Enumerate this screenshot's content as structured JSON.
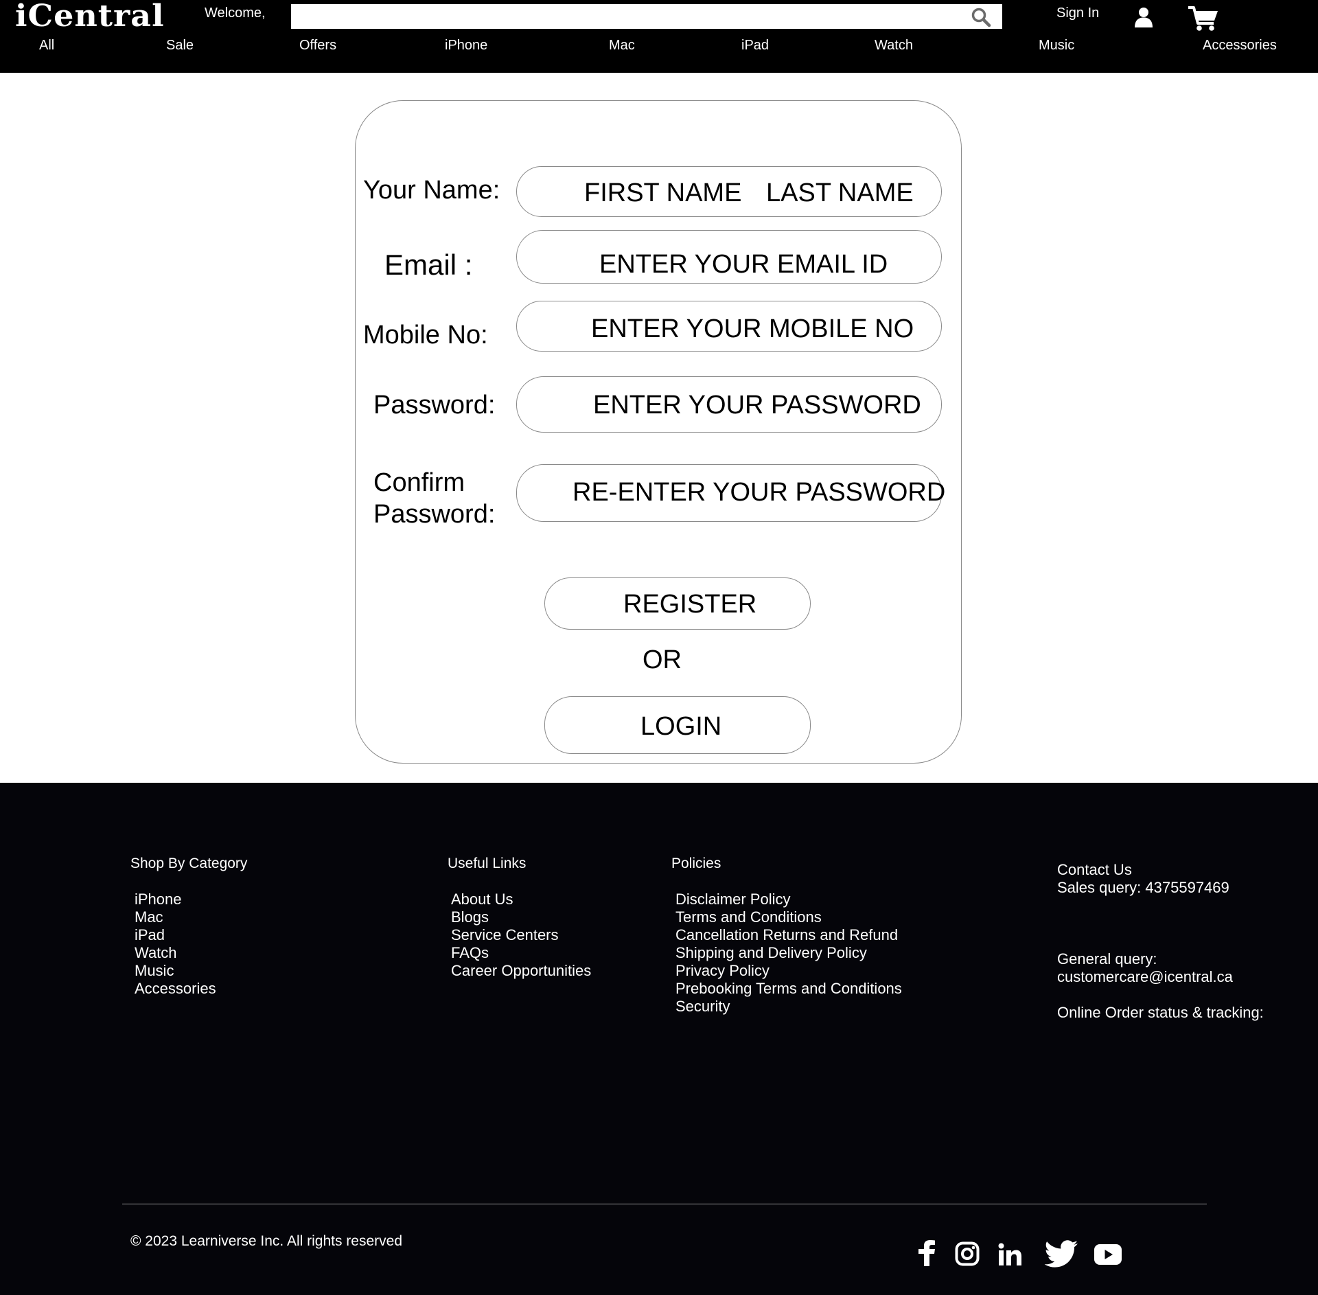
{
  "header": {
    "logo": "iCentral",
    "welcome": "Welcome,",
    "search_icon": "search-icon",
    "sign_in": "Sign In",
    "user_icon": "user-icon",
    "cart_icon": "cart-icon",
    "nav": [
      "All",
      "Sale",
      "Offers",
      "iPhone",
      "Mac",
      "iPad",
      "Watch",
      "Music",
      "Accessories"
    ]
  },
  "form": {
    "name_label": "Your Name:",
    "first_name_placeholder": "FIRST NAME",
    "last_name_placeholder": "LAST NAME",
    "email_label": "Email :",
    "email_placeholder": "ENTER YOUR EMAIL ID",
    "mobile_label": "Mobile No:",
    "mobile_placeholder": "ENTER YOUR MOBILE NO",
    "password_label": "Password:",
    "password_placeholder": "ENTER YOUR PASSWORD",
    "confirm_label_line1": "Confirm",
    "confirm_label_line2": "Password:",
    "confirm_placeholder": "RE-ENTER YOUR PASSWORD",
    "register_button": "REGISTER",
    "or_text": "OR",
    "login_button": "LOGIN"
  },
  "footer": {
    "shop_heading": "Shop By Category",
    "shop_items": [
      "iPhone",
      "Mac",
      "iPad",
      "Watch",
      "Music",
      "Accessories"
    ],
    "links_heading": "Useful Links",
    "links_items": [
      "About Us",
      "Blogs",
      "Service Centers",
      "FAQs",
      "Career Opportunities"
    ],
    "policies_heading": "Policies",
    "policies_items": [
      "Disclaimer Policy",
      "Terms and Conditions",
      "Cancellation Returns and Refund",
      "Shipping and Delivery Policy",
      "Privacy Policy",
      "Prebooking Terms and Conditions",
      "Security"
    ],
    "contact_heading": "Contact Us",
    "sales_query": "Sales query: 4375597469",
    "general_query_label": "General query:",
    "general_query_email": "customercare@icentral.ca",
    "order_status": "Online Order status & tracking:",
    "copyright": "© 2023 Learniverse Inc. All rights reserved",
    "social_icons": [
      "facebook-icon",
      "instagram-icon",
      "linkedin-icon",
      "twitter-icon",
      "youtube-icon"
    ]
  },
  "colors": {
    "header_bg": "#000000",
    "footer_bg": "#05050a",
    "border": "#8a8a8a",
    "search_icon": "#6b6b6b"
  }
}
